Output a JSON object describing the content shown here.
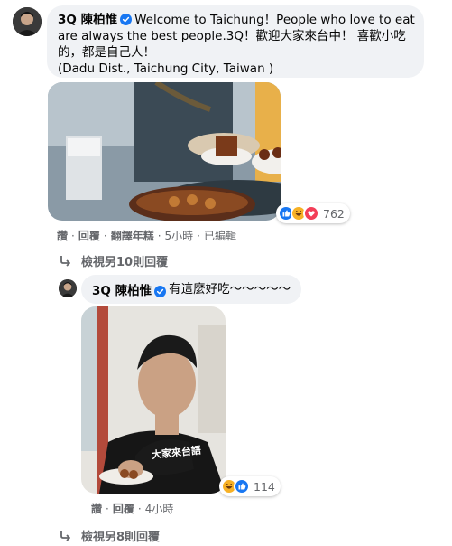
{
  "comment": {
    "author": "3Q 陳柏惟",
    "lines": [
      "Welcome to Taichung！People who love to eat",
      "are always the best people.3Q！歡迎大家來台中！ 喜歡小吃",
      "的，都是自己人！",
      "(Dadu Dist., Taichung City, Taiwan )"
    ],
    "reaction_count": "762",
    "actions": {
      "like": "讚",
      "reply": "回覆",
      "translate": "翻譯年糕",
      "time": "5小時",
      "edited": "已編輯"
    },
    "view_replies": "檢視另10則回覆"
  },
  "reply": {
    "author": "3Q 陳柏惟",
    "text": "有這麼好吃～～～～～",
    "shirt_text": "大家來台語",
    "reaction_count": "114",
    "actions": {
      "like": "讚",
      "reply": "回覆",
      "time": "4小時"
    }
  },
  "view_more_replies": "檢視另8則回覆",
  "colors": {
    "bubble": "#f0f2f5",
    "verified": "#1877f2",
    "meta_text": "#65676b"
  }
}
